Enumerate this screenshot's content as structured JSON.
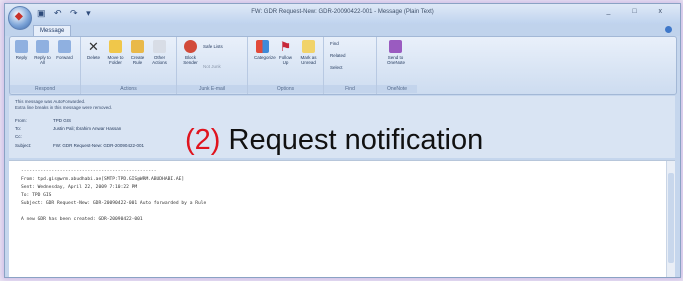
{
  "window": {
    "title": "FW: GDR Request-New: GDR-20090422-001 - Message (Plain Text)",
    "controls": "_ □ x"
  },
  "tabs": [
    {
      "label": "Message"
    }
  ],
  "ribbon": {
    "respond": {
      "label": "Respond",
      "buttons": [
        "Reply",
        "Reply to All",
        "Forward"
      ]
    },
    "actions": {
      "label": "Actions",
      "buttons": [
        "Delete",
        "Move to Folder",
        "Create Rule",
        "Other Actions"
      ]
    },
    "junk": {
      "label": "Junk E-mail",
      "buttons": [
        "Block Sender",
        "Safe Lists",
        "Not Junk"
      ]
    },
    "options": {
      "label": "Options",
      "buttons": [
        "Categorize",
        "Follow Up",
        "Mark as Unread"
      ]
    },
    "find": {
      "label": "Find",
      "buttons": [
        "Find",
        "Related",
        "Select"
      ]
    },
    "onenote": {
      "label": "OneNote",
      "buttons": [
        "Send to OneNote"
      ]
    }
  },
  "header": {
    "info_lines": [
      "This message was AutoForwarded.",
      "Extra line breaks in this message were removed."
    ],
    "from_label": "From:",
    "from_value": "TPD GIS",
    "to_label": "To:",
    "to_value": "Justin Pali; Ibrahim Anwar Hassan",
    "cc_label": "Cc:",
    "subject_label": "Subject:",
    "subject_value": "FW: GDR Request-New: GDR-20090422-001"
  },
  "overlay": {
    "number": "(2)",
    "text": "Request notification"
  },
  "body": {
    "separator": "-------------------------------------------------",
    "lines": [
      "From: tpd.gis@wrm.abudhabi.ae[SMTP:TPD.GIS@WRM.ABUDHABI.AE]",
      "Sent: Wednesday, April 22, 2009 7:10:22 PM",
      "To: TPD GIS",
      "Subject: GDR Request-New: GDR-20090422-001 Auto forwarded by a Rule",
      "",
      "A new GDR has been created: GDR-20090422-001"
    ]
  },
  "colors": {
    "overlay_number": "#e0141e",
    "ribbon_bg": "#dce7f6",
    "frame_glow": "#cdbde6"
  }
}
